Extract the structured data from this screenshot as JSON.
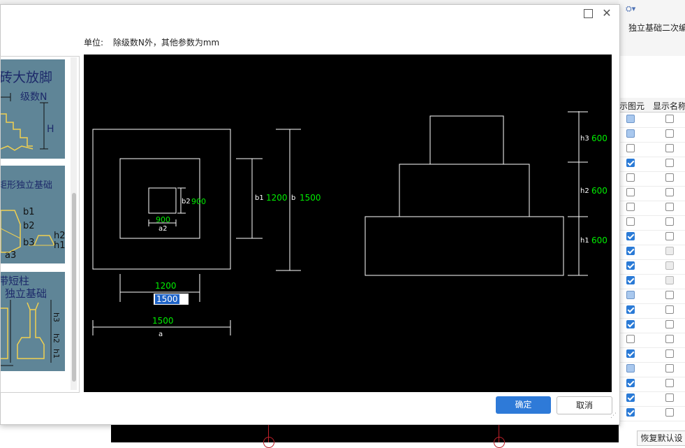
{
  "background": {
    "tab_title": "独立基础二次编",
    "grid_headers": [
      "示图元",
      "显示名称"
    ],
    "grid_rows": [
      [
        "partial",
        "empty"
      ],
      [
        "partial",
        "empty"
      ],
      [
        "empty",
        "empty"
      ],
      [
        "checked",
        "empty"
      ],
      [
        "empty",
        "empty"
      ],
      [
        "empty",
        "empty"
      ],
      [
        "empty",
        "empty"
      ],
      [
        "empty",
        "empty"
      ],
      [
        "checked",
        "empty"
      ],
      [
        "checked",
        "disabled"
      ],
      [
        "checked",
        "disabled"
      ],
      [
        "checked",
        "disabled"
      ],
      [
        "partial",
        "empty"
      ],
      [
        "checked",
        "empty"
      ],
      [
        "checked",
        "empty"
      ],
      [
        "empty",
        "empty"
      ],
      [
        "checked",
        "empty"
      ],
      [
        "partial",
        "empty"
      ],
      [
        "checked",
        "empty"
      ],
      [
        "checked",
        "empty"
      ],
      [
        "checked",
        "empty"
      ]
    ],
    "restore_button": "恢复默认设"
  },
  "dialog": {
    "unit_label": "单位:",
    "unit_text": "除级数N外，其他参数为mm",
    "ok_label": "确定",
    "cancel_label": "取消"
  },
  "thumbnails": [
    {
      "title": "砖大放脚",
      "labels": [
        "级数N",
        "H"
      ]
    },
    {
      "title": "矩形独立基础",
      "labels": [
        "b1",
        "b2",
        "b3",
        "a3",
        "h2",
        "h1"
      ]
    },
    {
      "title": "带短柱",
      "subtitle": "独立基础",
      "labels": [
        "h3",
        "h2",
        "h1"
      ]
    }
  ],
  "plan": {
    "a": "a",
    "a_value": "1500",
    "a1_input": "1500",
    "a1_value": "1200",
    "a2": "a2",
    "a2_value": "900",
    "b": "b",
    "b_value": "1500",
    "b1": "b1",
    "b1_value": "1200",
    "b2": "b2",
    "b2_value": "900"
  },
  "section": {
    "h1": "h1",
    "h1_value": "600",
    "h2": "h2",
    "h2_value": "600",
    "h3": "h3",
    "h3_value": "600"
  }
}
